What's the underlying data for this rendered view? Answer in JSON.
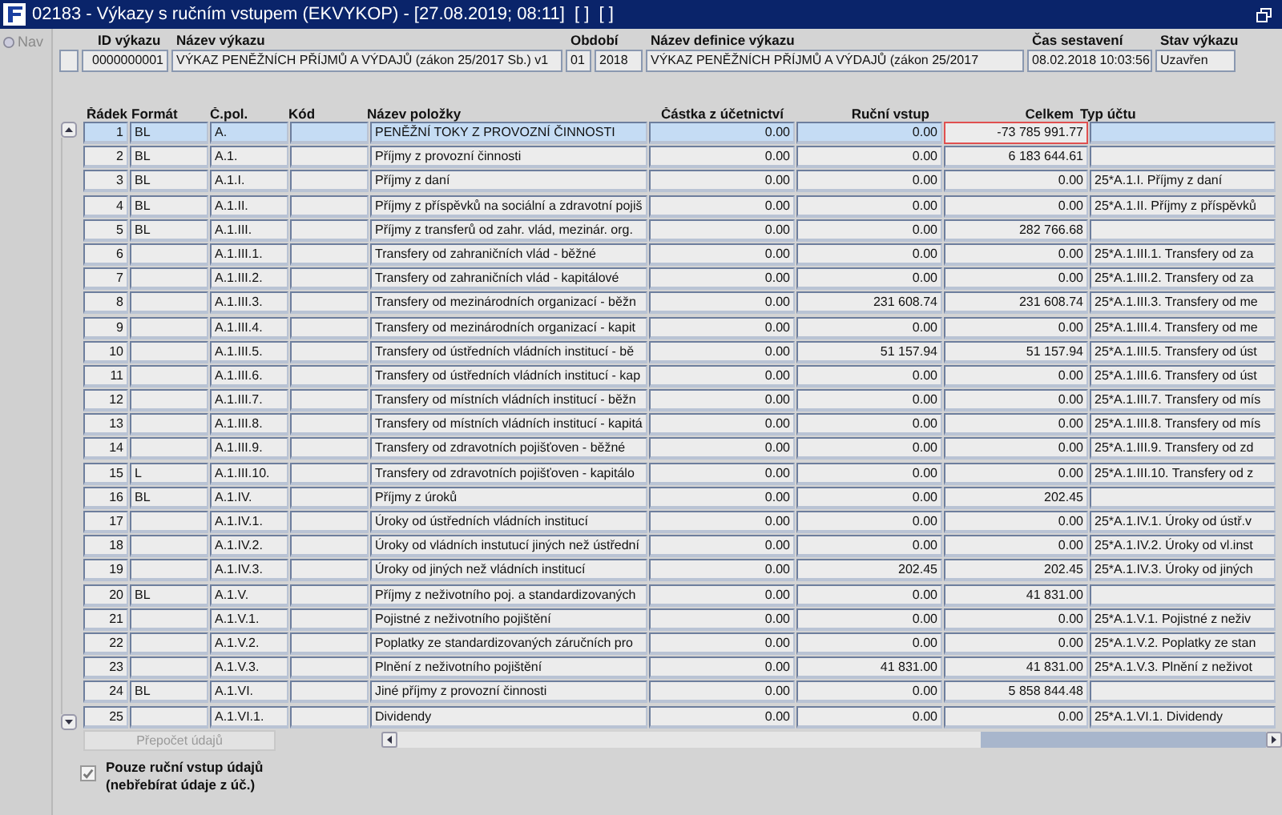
{
  "window": {
    "title": "02183 - Výkazy s ručním vstupem (EKVYKOP) - [27.08.2019; 08:11]  [ ]  [ ]"
  },
  "nav": {
    "label": "Nav"
  },
  "report": {
    "labels": [
      "ID výkazu",
      "Název výkazu",
      "Období",
      "Název definice výkazu",
      "Čas sestavení",
      "Stav výkazu"
    ],
    "id": "0000000001",
    "name": "VÝKAZ PENĚŽNÍCH PŘÍJMŮ A VÝDAJŮ (zákon 25/2017 Sb.) v1",
    "month": "01",
    "year": "2018",
    "definition": "VÝKAZ PENĚŽNÍCH PŘÍJMŮ A VÝDAJŮ (zákon 25/2017",
    "time": "08.02.2018 10:03:56",
    "status": "Uzavřen"
  },
  "table": {
    "columns": [
      "Řádek",
      "Formát",
      "Č.pol.",
      "Kód",
      "Název položky",
      "Částka z účetnictví",
      "Ruční vstup",
      "Celkem",
      "Typ účtu"
    ],
    "rows": [
      {
        "cells": [
          "1",
          "BL",
          "A.",
          "",
          "PENĚŽNÍ TOKY Z PROVOZNÍ ČINNOSTI",
          "0.00",
          "0.00",
          "-73 785 991.77",
          ""
        ],
        "selected": true
      },
      {
        "cells": [
          "2",
          "BL",
          "A.1.",
          "",
          "Příjmy z provozní činnosti",
          "0.00",
          "0.00",
          "6 183 644.61",
          ""
        ],
        "selected": false
      },
      {
        "cells": [
          "3",
          "BL",
          "A.1.I.",
          "",
          "Příjmy z daní",
          "0.00",
          "0.00",
          "0.00",
          "25*A.1.I. Příjmy z daní"
        ],
        "selected": false
      },
      {
        "cells": [
          "4",
          "BL",
          "A.1.II.",
          "",
          "Příjmy z příspěvků na sociální a zdravotní pojiš",
          "0.00",
          "0.00",
          "0.00",
          "25*A.1.II. Příjmy z příspěvků"
        ],
        "selected": false
      },
      {
        "cells": [
          "5",
          "BL",
          "A.1.III.",
          "",
          "Příjmy z transferů od zahr. vlád, mezinár. org.",
          "0.00",
          "0.00",
          "282 766.68",
          ""
        ],
        "selected": false
      },
      {
        "cells": [
          "6",
          "",
          "A.1.III.1.",
          "",
          "Transfery od zahraničních vlád - běžné",
          "0.00",
          "0.00",
          "0.00",
          "25*A.1.III.1. Transfery od za"
        ],
        "selected": false
      },
      {
        "cells": [
          "7",
          "",
          "A.1.III.2.",
          "",
          "Transfery od zahraničních vlád  - kapitálové",
          "0.00",
          "0.00",
          "0.00",
          "25*A.1.III.2. Transfery od za"
        ],
        "selected": false
      },
      {
        "cells": [
          "8",
          "",
          "A.1.III.3.",
          "",
          "Transfery od mezinárodních organizací - běžn",
          "0.00",
          "231 608.74",
          "231 608.74",
          "25*A.1.III.3. Transfery od me"
        ],
        "selected": false
      },
      {
        "cells": [
          "9",
          "",
          "A.1.III.4.",
          "",
          "Transfery od mezinárodních organizací - kapit",
          "0.00",
          "0.00",
          "0.00",
          "25*A.1.III.4. Transfery od me"
        ],
        "selected": false
      },
      {
        "cells": [
          "10",
          "",
          "A.1.III.5.",
          "",
          "Transfery od ústředních vládních institucí - bě",
          "0.00",
          "51 157.94",
          "51 157.94",
          "25*A.1.III.5. Transfery od úst"
        ],
        "selected": false
      },
      {
        "cells": [
          "11",
          "",
          "A.1.III.6.",
          "",
          "Transfery od ústředních vládních institucí - kap",
          "0.00",
          "0.00",
          "0.00",
          "25*A.1.III.6. Transfery od úst"
        ],
        "selected": false
      },
      {
        "cells": [
          "12",
          "",
          "A.1.III.7.",
          "",
          "Transfery od místních vládních institucí - běžn",
          "0.00",
          "0.00",
          "0.00",
          "25*A.1.III.7. Transfery od mís"
        ],
        "selected": false
      },
      {
        "cells": [
          "13",
          "",
          "A.1.III.8.",
          "",
          "Transfery od místních vládních institucí - kapitá",
          "0.00",
          "0.00",
          "0.00",
          "25*A.1.III.8. Transfery od mís"
        ],
        "selected": false
      },
      {
        "cells": [
          "14",
          "",
          "A.1.III.9.",
          "",
          "Transfery od zdravotních pojišťoven - běžné",
          "0.00",
          "0.00",
          "0.00",
          "25*A.1.III.9. Transfery od zd"
        ],
        "selected": false
      },
      {
        "cells": [
          "15",
          "L",
          "A.1.III.10.",
          "",
          "Transfery od zdravotních pojišťoven - kapitálo",
          "0.00",
          "0.00",
          "0.00",
          "25*A.1.III.10. Transfery od z"
        ],
        "selected": false
      },
      {
        "cells": [
          "16",
          "BL",
          "A.1.IV.",
          "",
          "Příjmy z úroků",
          "0.00",
          "0.00",
          "202.45",
          ""
        ],
        "selected": false
      },
      {
        "cells": [
          "17",
          "",
          "A.1.IV.1.",
          "",
          "Úroky od ústředních vládních institucí",
          "0.00",
          "0.00",
          "0.00",
          "25*A.1.IV.1. Úroky od ústř.v"
        ],
        "selected": false
      },
      {
        "cells": [
          "18",
          "",
          "A.1.IV.2.",
          "",
          "Úroky od vládních instutucí jiných než ústřední",
          "0.00",
          "0.00",
          "0.00",
          "25*A.1.IV.2. Úroky od vl.inst"
        ],
        "selected": false
      },
      {
        "cells": [
          "19",
          "",
          "A.1.IV.3.",
          "",
          "Úroky od jiných než vládních institucí",
          "0.00",
          "202.45",
          "202.45",
          "25*A.1.IV.3. Úroky od jiných"
        ],
        "selected": false
      },
      {
        "cells": [
          "20",
          "BL",
          "A.1.V.",
          "",
          "Příjmy z neživotního poj. a standardizovaných",
          "0.00",
          "0.00",
          "41 831.00",
          ""
        ],
        "selected": false
      },
      {
        "cells": [
          "21",
          "",
          "A.1.V.1.",
          "",
          "Pojistné z neživotního pojištění",
          "0.00",
          "0.00",
          "0.00",
          "25*A.1.V.1. Pojistné z neživ"
        ],
        "selected": false
      },
      {
        "cells": [
          "22",
          "",
          "A.1.V.2.",
          "",
          "Poplatky ze standardizovaných záručních pro",
          "0.00",
          "0.00",
          "0.00",
          "25*A.1.V.2. Poplatky ze stan"
        ],
        "selected": false
      },
      {
        "cells": [
          "23",
          "",
          "A.1.V.3.",
          "",
          "Plnění z neživotního pojištění",
          "0.00",
          "41 831.00",
          "41 831.00",
          "25*A.1.V.3. Plnění z neživot"
        ],
        "selected": false
      },
      {
        "cells": [
          "24",
          "BL",
          "A.1.VI.",
          "",
          "Jiné příjmy z provozní činnosti",
          "0.00",
          "0.00",
          "5 858 844.48",
          ""
        ],
        "selected": false
      },
      {
        "cells": [
          "25",
          "",
          "A.1.VI.1.",
          "",
          "Dividendy",
          "0.00",
          "0.00",
          "0.00",
          "25*A.1.VI.1. Dividendy"
        ],
        "selected": false
      }
    ]
  },
  "recalc_button": {
    "label": "Přepočet údajů",
    "disabled": true
  },
  "manual_only": {
    "lines": [
      "Pouze ruční vstup údajů",
      "(nebřebírat údaje z úč.)"
    ],
    "checked": true,
    "disabled": true
  }
}
